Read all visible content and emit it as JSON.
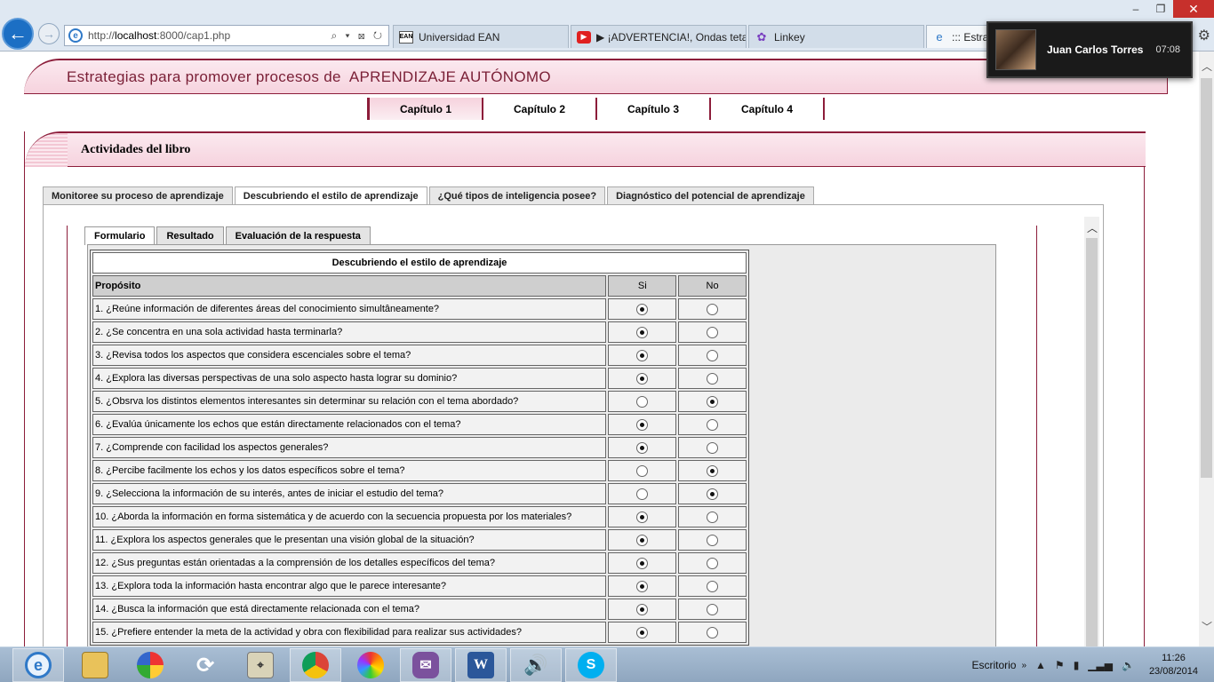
{
  "browser": {
    "url_prefix": "http://",
    "url_host": "localhost",
    "url_rest": ":8000/cap1.php",
    "address_tools": "⌕ ▾ ⊠ ↻",
    "tabs": [
      {
        "label": "Universidad EAN",
        "icon": "EAN"
      },
      {
        "label": "▶ ¡ADVERTENCIA!, Ondas teta ...",
        "icon": "▶"
      },
      {
        "label": "Linkey",
        "icon": "✿"
      },
      {
        "label": "::: Estrate",
        "icon": "e"
      }
    ],
    "window_controls": {
      "minimize": "‒",
      "restore": "❐",
      "close": "✕"
    }
  },
  "notification": {
    "name": "Juan Carlos Torres",
    "time": "07:08"
  },
  "header": {
    "title": "Estrategias para promover procesos de  APRENDIZAJE AUTÓNOMO"
  },
  "chapters": [
    "Capítulo 1",
    "Capítulo 2",
    "Capítulo 3",
    "Capítulo 4"
  ],
  "section": {
    "title": "Actividades del libro"
  },
  "outer_tabs": [
    "Monitoree su proceso de aprendizaje",
    "Descubriendo el estilo de aprendizaje",
    "¿Qué tipos de inteligencia posee?",
    "Diagnóstico del potencial de aprendizaje"
  ],
  "inner_tabs": [
    "Formulario",
    "Resultado",
    "Evaluación de la respuesta"
  ],
  "form": {
    "caption": "Descubriendo el estilo de aprendizaje",
    "col_purpose": "Propósito",
    "col_yes": "Si",
    "col_no": "No",
    "questions": [
      {
        "text": "1. ¿Reúne información de diferentes áreas del conocimiento simultâneamente?",
        "answer": "si"
      },
      {
        "text": "2. ¿Se concentra en una sola actividad hasta terminarla?",
        "answer": "si"
      },
      {
        "text": "3. ¿Revisa todos los aspectos que considera escenciales sobre el tema?",
        "answer": "si"
      },
      {
        "text": "4. ¿Explora las diversas perspectivas de una solo aspecto hasta lograr su dominio?",
        "answer": "si"
      },
      {
        "text": "5. ¿Obsrva los distintos elementos interesantes sin determinar su relación con el tema abordado?",
        "answer": "no"
      },
      {
        "text": "6. ¿Evalúa únicamente los echos que están directamente relacionados con el tema?",
        "answer": "si"
      },
      {
        "text": "7. ¿Comprende con facilidad los aspectos generales?",
        "answer": "si"
      },
      {
        "text": "8. ¿Percibe facilmente los echos y los datos específicos sobre el tema?",
        "answer": "no"
      },
      {
        "text": "9. ¿Selecciona la información de su interés, antes de iniciar el estudio del tema?",
        "answer": "no"
      },
      {
        "text": "10. ¿Aborda la información en forma sistemática y de acuerdo con la secuencia propuesta por los materiales?",
        "answer": "si"
      },
      {
        "text": "11. ¿Explora los aspectos generales que le presentan una visión global de la situación?",
        "answer": "si"
      },
      {
        "text": "12. ¿Sus preguntas están orientadas a la comprensión de los detalles específicos del tema?",
        "answer": "si"
      },
      {
        "text": "13. ¿Explora toda la información hasta encontrar algo que le parece interesante?",
        "answer": "si"
      },
      {
        "text": "14. ¿Busca la información que está directamente relacionada con el tema?",
        "answer": "si"
      },
      {
        "text": "15. ¿Prefiere entender la meta de la actividad y obra con flexibilidad para realizar sus actividades?",
        "answer": "si"
      }
    ]
  },
  "taskbar": {
    "apps": [
      "ie-icon",
      "file-explorer-icon",
      "picasa-icon",
      "sync-icon",
      "maps-icon",
      "chrome-icon",
      "flower-icon",
      "viber-icon",
      "word-icon",
      "audio-icon",
      "skype-icon"
    ],
    "desktop_label": "Escritorio",
    "time": "11:26",
    "date": "23/08/2014"
  },
  "colors": {
    "accent": "#8c1d3a",
    "banner": "#f6d3de",
    "browser_blue": "#1c6fc4"
  }
}
